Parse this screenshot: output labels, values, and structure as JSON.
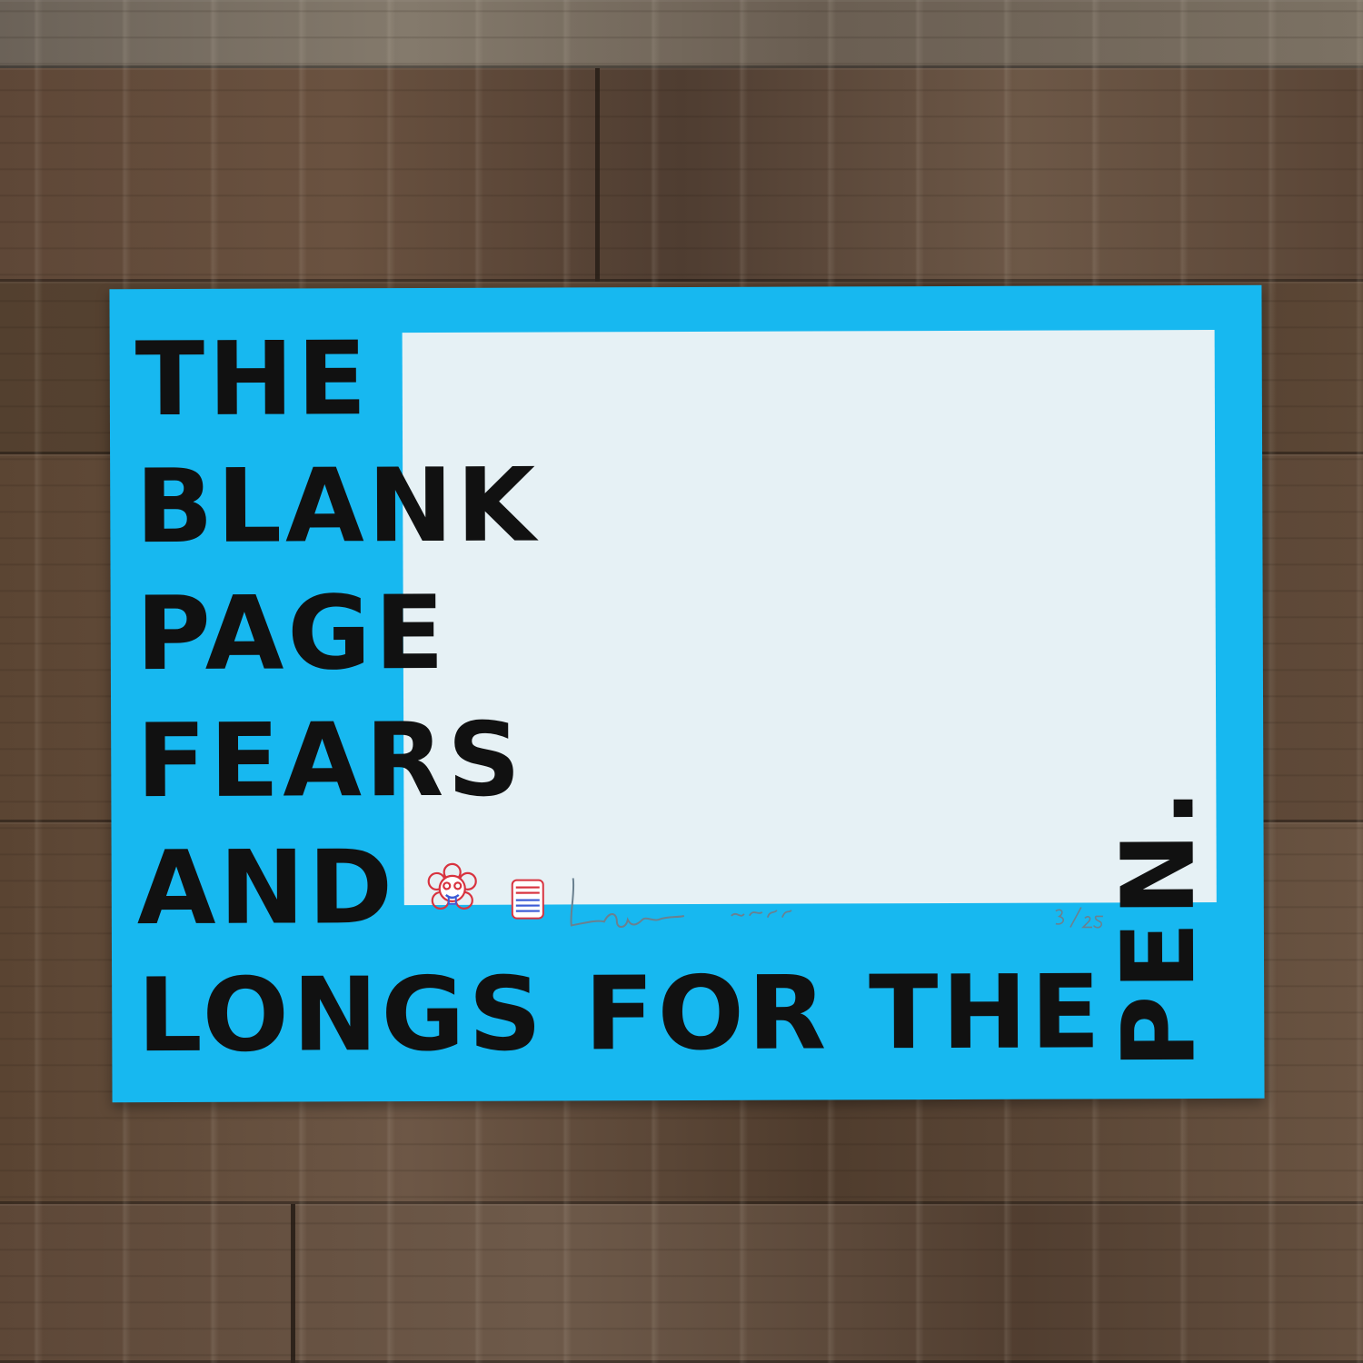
{
  "print": {
    "colors": {
      "border": "#17b8f0",
      "blank_area": "#e6f1f5",
      "ink": "#111111",
      "stamp_red": "#d8333f",
      "stamp_blue": "#3b5bd6",
      "pencil": "#6a8190"
    },
    "slogan_lines": [
      "THE",
      "BLANK",
      "PAGE",
      "FEARS",
      "AND",
      "LONGS FOR THE"
    ],
    "vertical_word": "PEN.",
    "stamps": [
      "flower-face-stamp",
      "square-logo-stamp"
    ],
    "signature_year": "2021",
    "edition": "3/25"
  },
  "background": {
    "surface": "weathered-wood-planks"
  }
}
